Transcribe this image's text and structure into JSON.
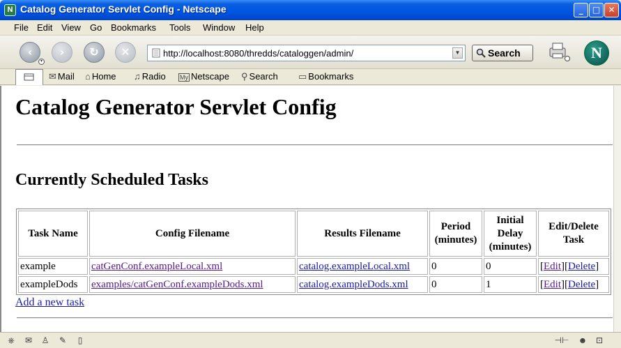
{
  "window": {
    "title": "Catalog Generator Servlet Config - Netscape"
  },
  "menu": [
    "File",
    "Edit",
    "View",
    "Go",
    "Bookmarks",
    "Tools",
    "Window",
    "Help"
  ],
  "nav": {
    "url": "http://localhost:8080/thredds/cataloggen/admin/",
    "search_label": "Search"
  },
  "personal": {
    "mail": "Mail",
    "home": "Home",
    "radio": "Radio",
    "netscape": "Netscape",
    "search": "Search",
    "bookmarks": "Bookmarks"
  },
  "page": {
    "heading": "Catalog Generator Servlet Config",
    "subheading": "Currently Scheduled Tasks",
    "columns": [
      "Task Name",
      "Config Filename",
      "Results Filename",
      "Period (minutes)",
      "Initial Delay (minutes)",
      "Edit/Delete Task"
    ],
    "rows": [
      {
        "name": "example",
        "config": "catGenConf.exampleLocal.xml",
        "results": "catalog.exampleLocal.xml",
        "period": "0",
        "delay": "0",
        "edit": "Edit",
        "delete": "Delete"
      },
      {
        "name": "exampleDods",
        "config": "examples/catGenConf.exampleDods.xml",
        "results": "catalog.exampleDods.xml",
        "period": "0",
        "delay": "1",
        "edit": "Edit",
        "delete": "Delete"
      }
    ],
    "add_link": "Add a new task"
  },
  "colors": {
    "titlebar": "#0054e3",
    "link": "#1a1aa6",
    "visited_link": "#551a8b"
  }
}
